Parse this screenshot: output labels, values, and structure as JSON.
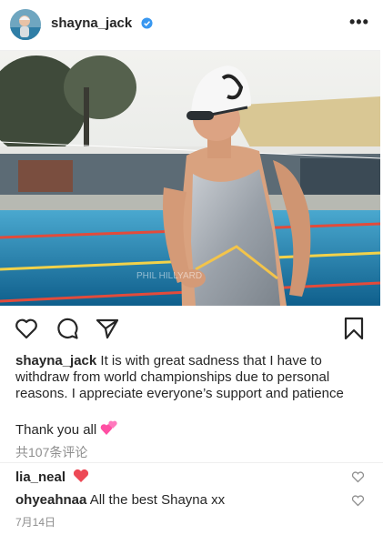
{
  "post": {
    "username": "shayna_jack",
    "verified": true,
    "more_label": "•••",
    "photo_watermark": "PHIL HILLYARD"
  },
  "actions": {
    "like_icon": "heart-outline-icon",
    "comment_icon": "comment-bubble-icon",
    "share_icon": "paper-plane-icon",
    "save_icon": "bookmark-icon"
  },
  "caption": {
    "username": "shayna_jack",
    "text": "It is with great sadness that I have to withdraw from world championships due to personal reasons. I appreciate everyone’s support and patience",
    "thanks": "Thank you all",
    "emoji": "two-hearts-emoji"
  },
  "comments_link": "共107条评论",
  "comments": [
    {
      "username": "lia_neal",
      "text": "",
      "emoji": "red-heart-emoji"
    },
    {
      "username": "ohyeahnaa",
      "text": "All the best Shayna xx"
    }
  ],
  "date": "7月14日",
  "colors": {
    "verified_blue": "#3897f0",
    "text": "#262626",
    "muted": "#8e8e8e",
    "heart_red": "#ed4956",
    "heart_pink": "#ff4fa3"
  }
}
